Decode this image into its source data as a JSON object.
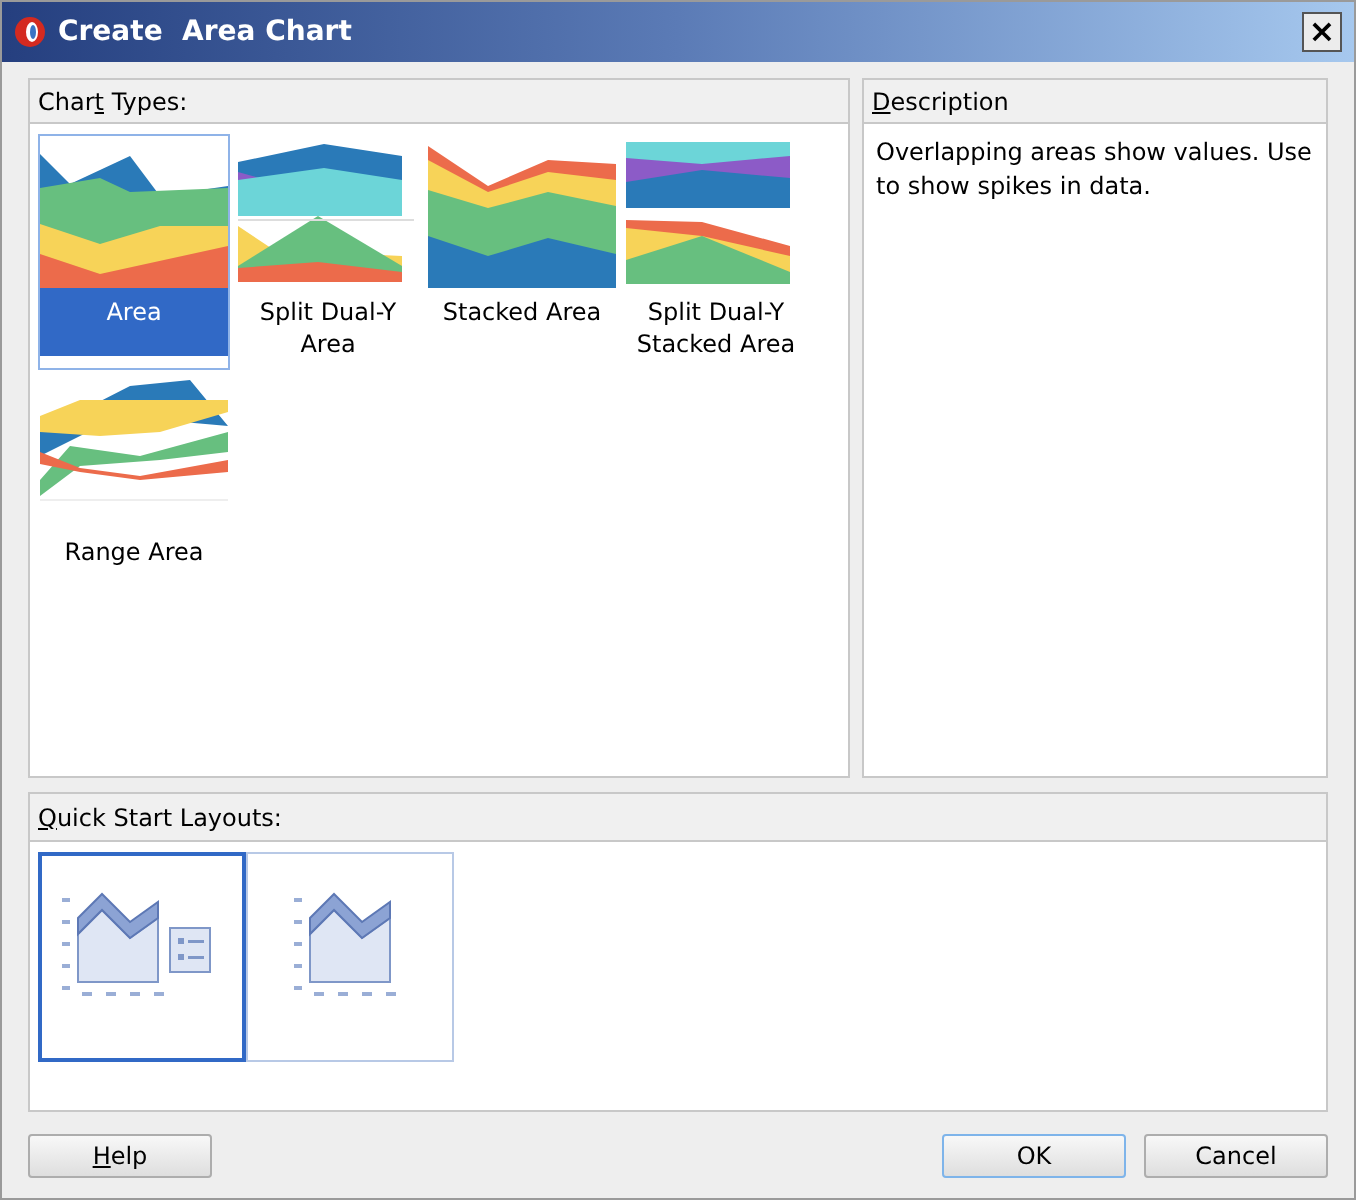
{
  "window": {
    "title": "Create  Area Chart",
    "close": "×"
  },
  "chart_types": {
    "label": {
      "before": "Char",
      "key": "t",
      "after": " Types:"
    },
    "items": [
      {
        "kind": "area",
        "label": "Area",
        "selected": true
      },
      {
        "kind": "split_dual_y",
        "label": "Split Dual-Y Area",
        "selected": false
      },
      {
        "kind": "stacked",
        "label": "Stacked Area",
        "selected": false
      },
      {
        "kind": "split_dual_y_stacked",
        "label": "Split Dual-Y Stacked Area",
        "selected": false
      },
      {
        "kind": "range",
        "label": "Range Area",
        "selected": false
      }
    ]
  },
  "description": {
    "label": {
      "key": "D",
      "after": "escription"
    },
    "text": "Overlapping areas show values. Use to show spikes in data."
  },
  "quick_start": {
    "label": {
      "key": "Q",
      "after": "uick Start Layouts:"
    },
    "items": [
      {
        "kind": "with_legend",
        "selected": true
      },
      {
        "kind": "plain",
        "selected": false
      }
    ]
  },
  "buttons": {
    "help": {
      "key": "H",
      "after": "elp"
    },
    "ok": "OK",
    "cancel": "Cancel"
  }
}
